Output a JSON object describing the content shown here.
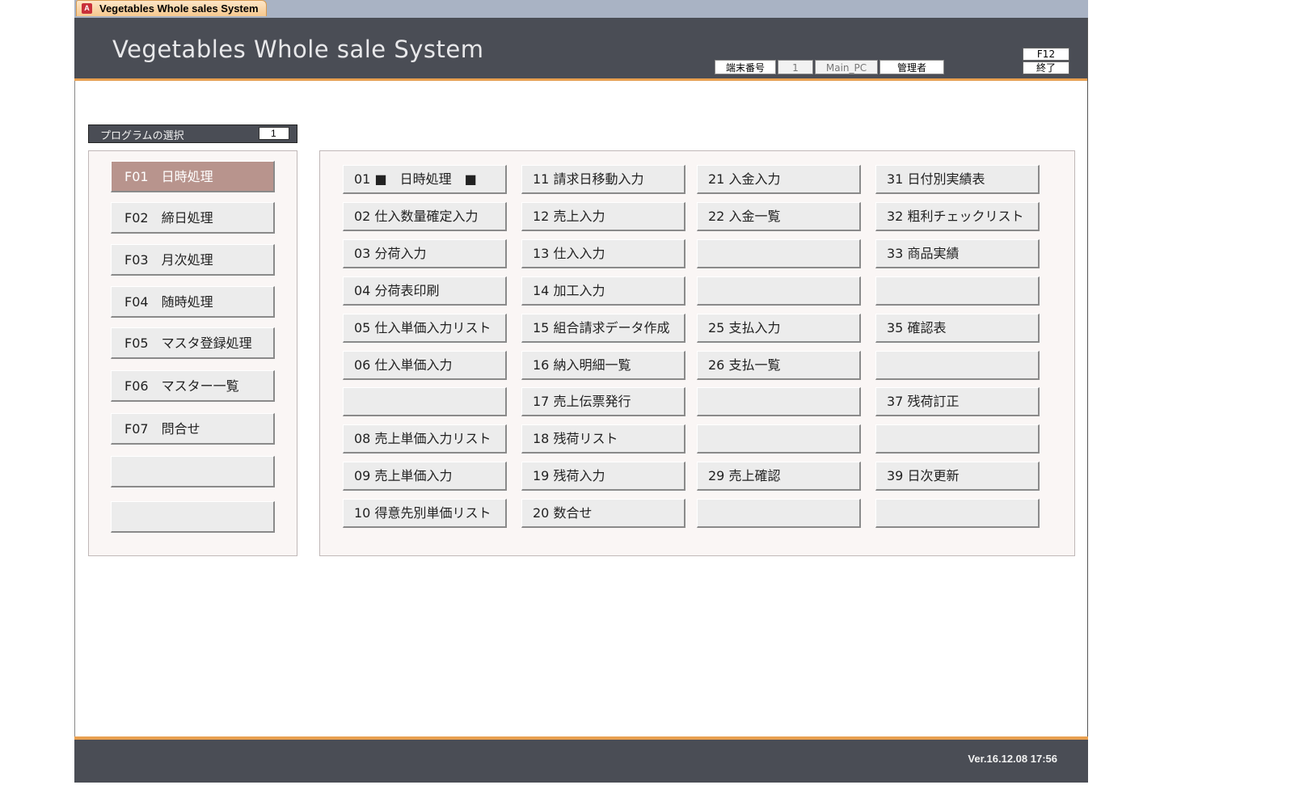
{
  "window": {
    "tab_title": "Vegetables Whole sales System",
    "app_icon": "access-app-icon"
  },
  "header": {
    "title": "Vegetables Whole sale System",
    "terminal_label": "端末番号",
    "terminal_number": "1",
    "machine_name": "Main_PC",
    "user_role": "管理者",
    "f12_key": "F12",
    "f12_label": "終了"
  },
  "program_select": {
    "label": "プログラムの選択",
    "value": "1"
  },
  "categories": [
    {
      "label": "F01　日時処理",
      "active": true
    },
    {
      "label": "F02　締日処理",
      "active": false
    },
    {
      "label": "F03　月次処理",
      "active": false
    },
    {
      "label": "F04　随時処理",
      "active": false
    },
    {
      "label": "F05　マスタ登録処理",
      "active": false
    },
    {
      "label": "F06　マスター一覧",
      "active": false
    },
    {
      "label": "F07　問合せ",
      "active": false
    },
    {
      "label": "",
      "active": false
    },
    {
      "label": "",
      "active": false
    }
  ],
  "programs": [
    [
      "01 ■　日時処理　■",
      "11 請求日移動入力",
      "21 入金入力",
      "31 日付別実績表"
    ],
    [
      "02 仕入数量確定入力",
      "12 売上入力",
      "22 入金一覧",
      "32 粗利チェックリスト"
    ],
    [
      "03 分荷入力",
      "13 仕入入力",
      "",
      "33 商品実績"
    ],
    [
      "04 分荷表印刷",
      "14 加工入力",
      "",
      ""
    ],
    [
      "05 仕入単価入力リスト",
      "15 組合請求データ作成",
      "25 支払入力",
      "35 確認表"
    ],
    [
      "06 仕入単価入力",
      "16 納入明細一覧",
      "26 支払一覧",
      ""
    ],
    [
      "",
      "17 売上伝票発行",
      "",
      "37 残荷訂正"
    ],
    [
      "08 売上単価入力リスト",
      "18 残荷リスト",
      "",
      ""
    ],
    [
      "09 売上単価入力",
      "19 残荷入力",
      "29 売上確認",
      "39 日次更新"
    ],
    [
      "10 得意先別単価リスト",
      "20 数合せ",
      "",
      ""
    ]
  ],
  "footer": {
    "version": "Ver.16.12.08 17:56"
  },
  "colors": {
    "header_bg": "#4a4d55",
    "accent_orange": "#e8a050",
    "active_button": "#b8948d"
  }
}
